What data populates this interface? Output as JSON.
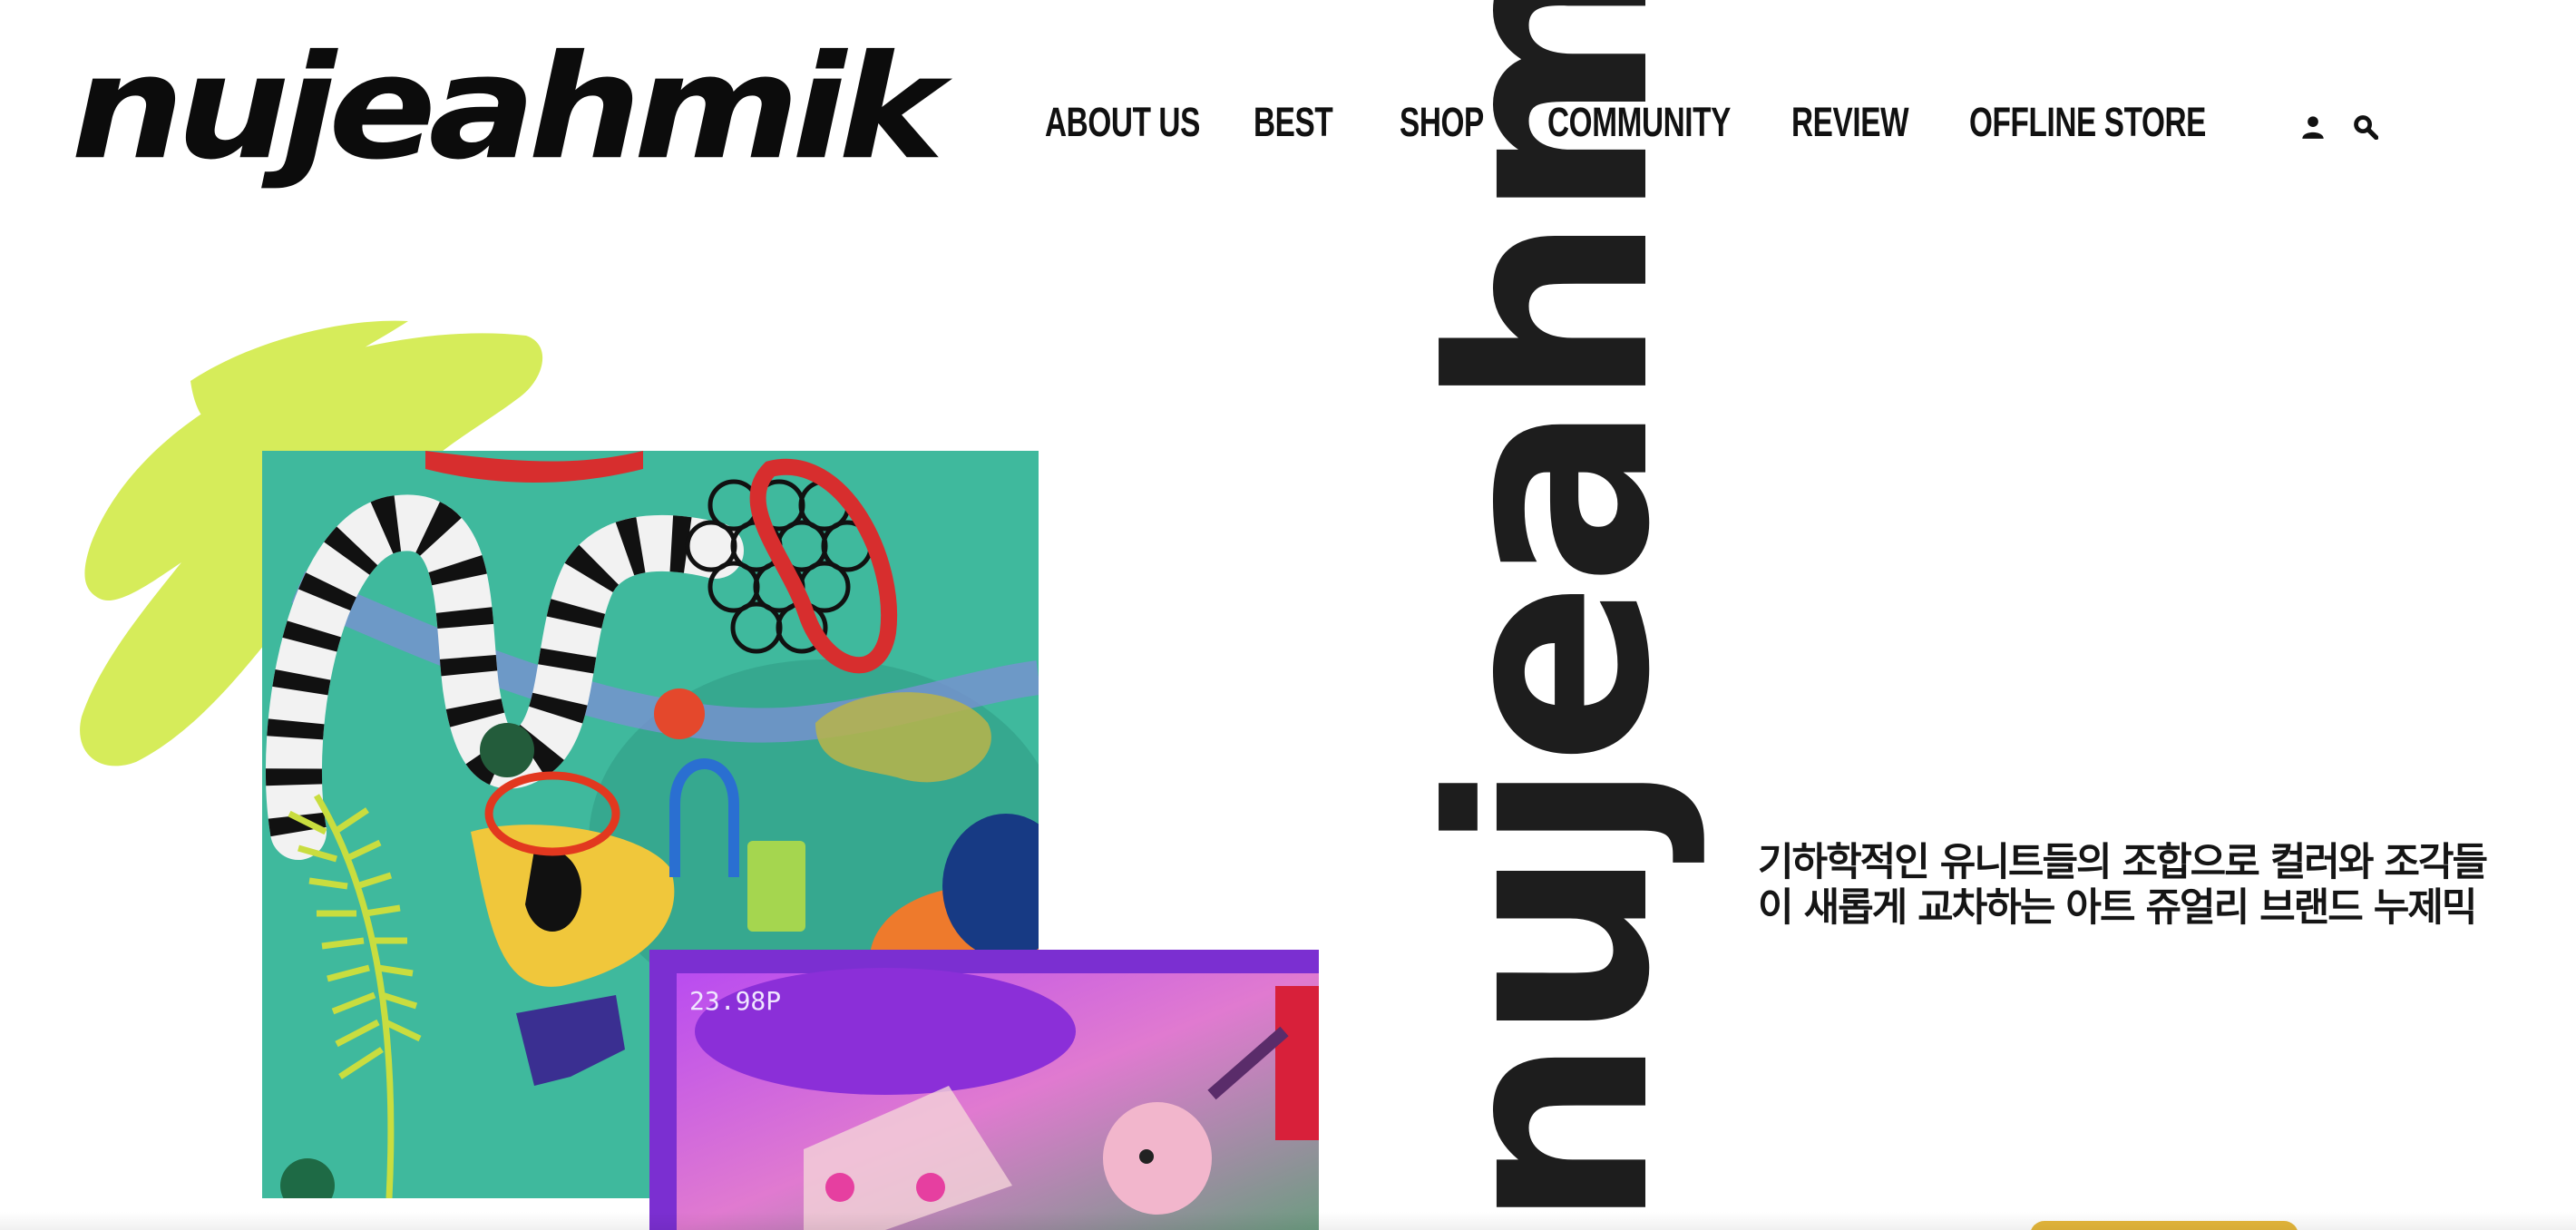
{
  "brand": {
    "logo_text": "nujeahmik",
    "vertical_text": "nujeahmik"
  },
  "nav": {
    "items": [
      {
        "label": "ABOUT US"
      },
      {
        "label": "BEST"
      },
      {
        "label": "SHOP"
      },
      {
        "label": "COMMUNITY"
      },
      {
        "label": "REVIEW"
      },
      {
        "label": "OFFLINE STORE"
      }
    ],
    "icons": [
      "user-icon",
      "search-icon"
    ]
  },
  "hero": {
    "tagline": "기하학적인 유니트들의 조합으로 컬러와 조각들이 새롭게 교차하는 아트 쥬얼리 브랜드 누제믹",
    "camera_readout": "23.98P",
    "art_main_icon": "jewelry-artwork-image",
    "art_second_icon": "product-render-image"
  },
  "colors": {
    "accent_lime": "#d6ec5a",
    "cta_gold": "#e5b73b",
    "text_dark": "#111111",
    "art_teal": "#3fb99d",
    "art_purple": "#7b2fd1"
  }
}
